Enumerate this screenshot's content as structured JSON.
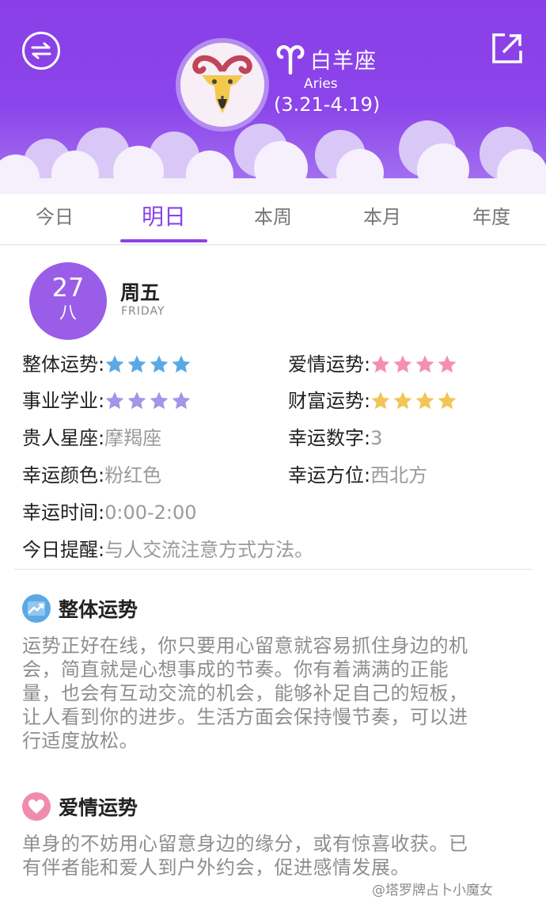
{
  "header": {
    "sign_name": "白羊座",
    "sign_en": "Aries",
    "sign_range": "(3.21-4.19)"
  },
  "tabs": [
    {
      "label": "今日",
      "active": false
    },
    {
      "label": "明日",
      "active": true
    },
    {
      "label": "本周",
      "active": false
    },
    {
      "label": "本月",
      "active": false
    },
    {
      "label": "年度",
      "active": false
    }
  ],
  "date": {
    "day": "27",
    "lunar": "八",
    "weekday": "周五",
    "weekday_en": "FRIDAY"
  },
  "stats": {
    "overall": {
      "label": "整体运势:",
      "stars": 4,
      "color": "#5aa9e6"
    },
    "love": {
      "label": "爱情运势:",
      "stars": 4,
      "color": "#f48fb1"
    },
    "career": {
      "label": "事业学业:",
      "stars": 4,
      "color": "#a694e8"
    },
    "wealth": {
      "label": "财富运势:",
      "stars": 4,
      "color": "#f3c456"
    },
    "noble_label": "贵人星座:",
    "noble_value": "摩羯座",
    "number_label": "幸运数字:",
    "number_value": "3",
    "color_label": "幸运颜色:",
    "color_value": "粉红色",
    "direction_label": "幸运方位:",
    "direction_value": "西北方",
    "time_label": "幸运时间:",
    "time_value": "0:00-2:00",
    "reminder_label": "今日提醒:",
    "reminder_value": "与人交流注意方式方法。"
  },
  "sections": {
    "overall": {
      "title": "整体运势",
      "icon": "trend-chart-icon",
      "lines": [
        "运势正好在线，你只要用心留意就容易抓住身边的机",
        "会，简直就是心想事成的节奏。你有着满满的正能",
        "量，也会有互动交流的机会，能够补足自己的短板，",
        "让人看到你的进步。生活方面会保持慢节奏，可以进",
        "行适度放松。"
      ]
    },
    "love": {
      "title": "爱情运势",
      "icon": "heart-icon",
      "lines": [
        "单身的不妨用心留意身边的缘分，或有惊喜收获。已",
        "有伴者能和爱人到户外约会，促进感情发展。"
      ]
    }
  },
  "watermark": "@塔罗牌占卜小魔女",
  "colors": {
    "accent": "#8a44e6",
    "header_top": "#8a3fe6"
  }
}
